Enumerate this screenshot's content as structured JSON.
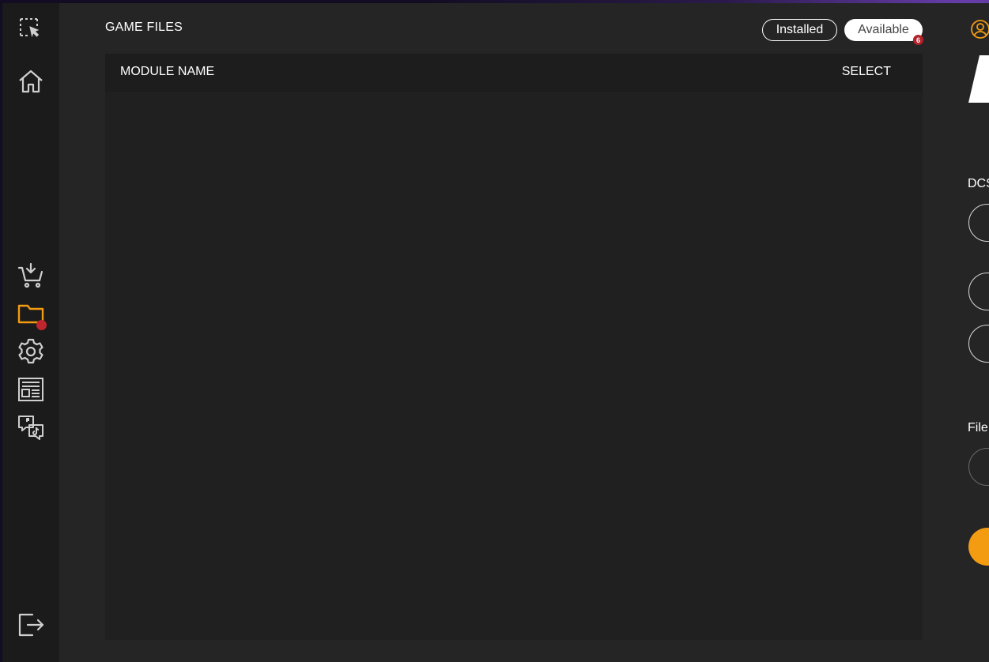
{
  "sidebar": {
    "items": [
      {
        "name": "select-tool-icon"
      },
      {
        "name": "home-icon"
      },
      {
        "name": "download-cart-icon"
      },
      {
        "name": "folder-icon",
        "active": true,
        "color": "#f39c12",
        "has_notification": true
      },
      {
        "name": "settings-icon"
      },
      {
        "name": "news-icon"
      },
      {
        "name": "social-chat-icon"
      },
      {
        "name": "logout-icon"
      }
    ],
    "notification_color": "#c0262d"
  },
  "main": {
    "title": "GAME FILES",
    "tabs": [
      {
        "label": "Installed",
        "selected": false
      },
      {
        "label": "Available",
        "selected": true,
        "badge": "6"
      }
    ],
    "table": {
      "columns": [
        "MODULE NAME",
        "SELECT"
      ],
      "rows": []
    }
  },
  "right_panel": {
    "labels": [
      "DCS",
      "File"
    ],
    "accent_color": "#f39c12"
  }
}
